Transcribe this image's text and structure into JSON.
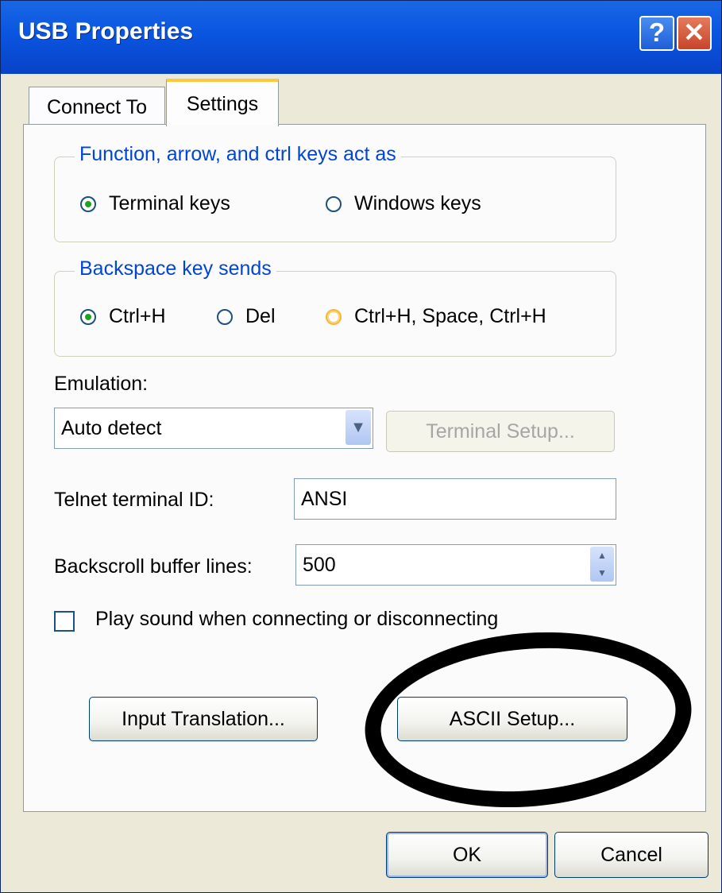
{
  "window": {
    "title": "USB Properties",
    "help_glyph": "?",
    "close_glyph": "✕"
  },
  "tabs": [
    {
      "label": "Connect To"
    },
    {
      "label": "Settings"
    }
  ],
  "function_keys_group": {
    "legend": "Function, arrow, and ctrl keys act as",
    "options": [
      {
        "label": "Terminal keys",
        "selected": true
      },
      {
        "label": "Windows keys",
        "selected": false
      }
    ]
  },
  "backspace_group": {
    "legend": "Backspace key sends",
    "options": [
      {
        "label": "Ctrl+H",
        "selected": true
      },
      {
        "label": "Del",
        "selected": false
      },
      {
        "label": "Ctrl+H, Space, Ctrl+H",
        "selected": false
      }
    ]
  },
  "emulation": {
    "label": "Emulation:",
    "value": "Auto detect",
    "terminal_setup_label": "Terminal Setup..."
  },
  "telnet": {
    "label": "Telnet terminal ID:",
    "value": "ANSI"
  },
  "backscroll": {
    "label": "Backscroll buffer lines:",
    "value": "500"
  },
  "play_sound": {
    "label": "Play sound when connecting or disconnecting",
    "checked": false
  },
  "buttons": {
    "input_translation": "Input Translation...",
    "ascii_setup": "ASCII Setup...",
    "ok": "OK",
    "cancel": "Cancel"
  },
  "colors": {
    "title_bar": "#0a55e0",
    "legend_text": "#0046d5",
    "annotation": "#000000"
  }
}
